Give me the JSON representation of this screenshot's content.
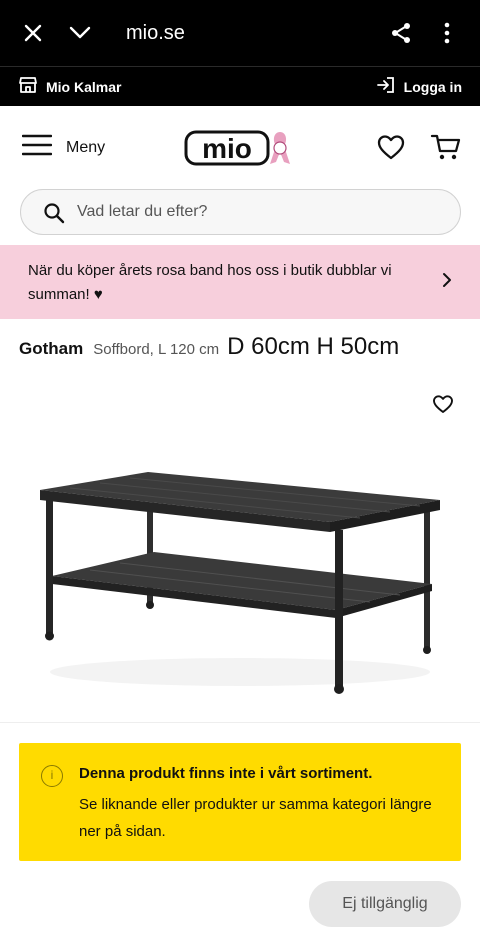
{
  "browser": {
    "url": "mio.se",
    "icons": [
      "close-icon",
      "chevron-down-icon",
      "share-icon",
      "more-vert-icon"
    ]
  },
  "store_bar": {
    "store_label": "Mio Kalmar",
    "login_label": "Logga in"
  },
  "header": {
    "menu_label": "Meny",
    "logo_text": "mio"
  },
  "search": {
    "placeholder": "Vad letar du efter?"
  },
  "promo": {
    "text": "När du köper årets rosa band hos oss i butik dubblar vi summan! ♥"
  },
  "product": {
    "brand": "Gotham",
    "description": "Soffbord, L 120 cm",
    "dimensions": "D 60cm  H 50cm"
  },
  "notice": {
    "heading": "Denna produkt finns inte i vårt sortiment.",
    "body": "Se liknande eller produkter ur samma kategori längre ner på sidan."
  },
  "actions": {
    "unavailable_label": "Ej tillgänglig"
  },
  "colors": {
    "promo_bg": "#f7cfdc",
    "notice_bg": "#ffdb00",
    "brand_pink": "#e8a0bf"
  }
}
